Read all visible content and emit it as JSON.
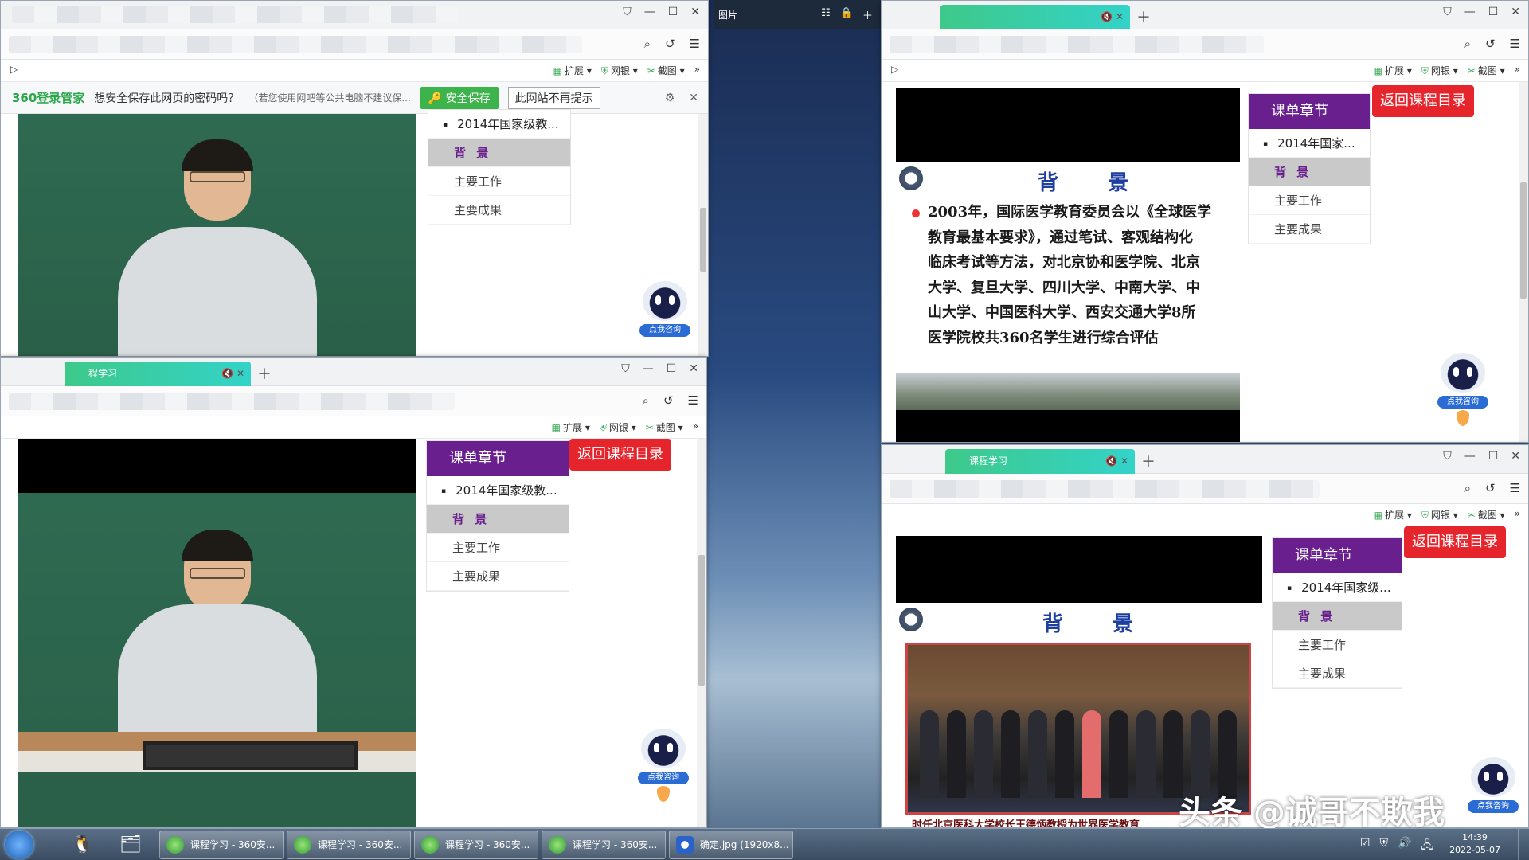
{
  "notify_bar": {
    "logo": "360登录管家",
    "question": "想安全保存此网页的密码吗？",
    "hint": "（若您使用网吧等公共电脑不建议保...",
    "save_button": "安全保存",
    "no_more_button": "此网站不再提示"
  },
  "bookmarks": {
    "extensions": "扩展",
    "netbank": "网银",
    "screenshot": "截图"
  },
  "tabs": {
    "course_tab_partial": "程学习",
    "course_tab": "课程学习"
  },
  "chapter": {
    "header": "课单章节",
    "course_full": "2014年国家级教...",
    "course_short_1": "2014年国家...",
    "course_short_2": "2014年国家级...",
    "background": "背 景",
    "main_work": "主要工作",
    "main_results": "主要成果",
    "return_button": "返回课程目录"
  },
  "robot": {
    "label": "点我咨询"
  },
  "slides": {
    "title": "背　景",
    "paragraph_lines": [
      "2003年，国际医学教育委员会以《全球医学",
      "教育最基本要求》，通过笔试、客观结构化",
      "临床考试等方法，对北京协和医学院、北京",
      "大学、复旦大学、四川大学、中南大学、中",
      "山大学、中国医科大学、西安交通大学8所",
      "医学院校共360名学生进行综合评估"
    ],
    "caption": "时任北京医科大学校长王德炳教授为世界医学教育"
  },
  "viewer": {
    "title": "图片"
  },
  "taskbar": {
    "tasks": [
      "课程学习 - 360安...",
      "课程学习 - 360安...",
      "课程学习 - 360安...",
      "课程学习 - 360安...",
      "确定.jpg (1920x8..."
    ],
    "clock_time": "14:39",
    "clock_date": "2022-05-07"
  },
  "watermark": "头条 @诚哥不欺我",
  "colors": {
    "chapter_header": "#6a1f8e",
    "return_button": "#e5242b",
    "tab_gradient_start": "#3ec98a",
    "notify_save": "#3cb44b"
  },
  "icons": [
    "shield-icon",
    "search-icon",
    "refresh-icon",
    "menu-icon",
    "gear-icon",
    "close-icon",
    "minimize-icon",
    "maximize-icon",
    "skin-icon",
    "robot-icon",
    "qq-icon",
    "folder-icon",
    "start-orb-icon"
  ]
}
